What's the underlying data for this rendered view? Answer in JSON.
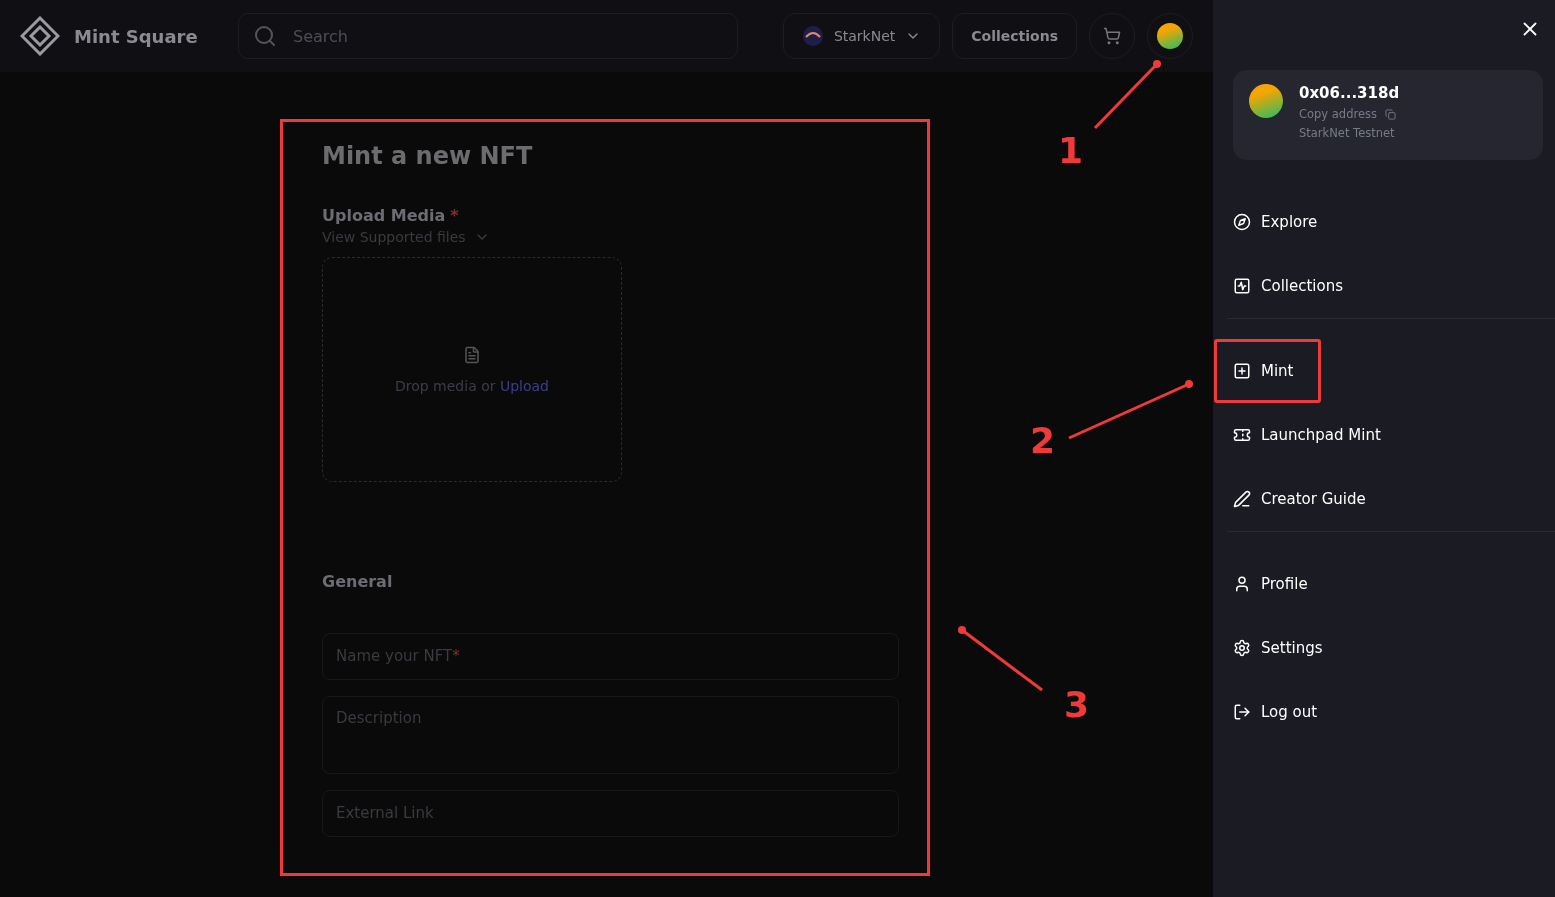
{
  "header": {
    "logo": "Mint Square",
    "search": {
      "placeholder": "Search"
    },
    "network": "StarkNet",
    "collections": "Collections"
  },
  "form": {
    "annotated": true,
    "title": "Mint a new NFT",
    "upload_label": "Upload Media",
    "required_mark": "*",
    "supported": "View Supported files",
    "drop_text": "Drop media or",
    "upload_link": "Upload",
    "general": "General",
    "fields": [
      {
        "placeholder": "Name your NFT",
        "required": true,
        "kind": "input"
      },
      {
        "placeholder": "Description",
        "required": false,
        "kind": "textarea"
      },
      {
        "placeholder": "External Link",
        "required": false,
        "kind": "input"
      }
    ]
  },
  "account": {
    "address": "0x06...318d",
    "copy": "Copy address",
    "network": "StarkNet Testnet"
  },
  "menu": [
    [
      {
        "label": "Explore",
        "kind": "explore",
        "annotated": false
      },
      {
        "label": "Collections",
        "kind": "collections",
        "annotated": false
      }
    ],
    [
      {
        "label": "Mint",
        "kind": "mint",
        "annotated": true
      },
      {
        "label": "Launchpad Mint",
        "kind": "launchpad",
        "annotated": false
      },
      {
        "label": "Creator Guide",
        "kind": "guide",
        "annotated": false
      }
    ],
    [
      {
        "label": "Profile",
        "kind": "profile",
        "annotated": false
      },
      {
        "label": "Settings",
        "kind": "settings",
        "annotated": false
      },
      {
        "label": "Log out",
        "kind": "logout",
        "annotated": false
      }
    ]
  ],
  "annotations": [
    "1",
    "2",
    "3"
  ]
}
